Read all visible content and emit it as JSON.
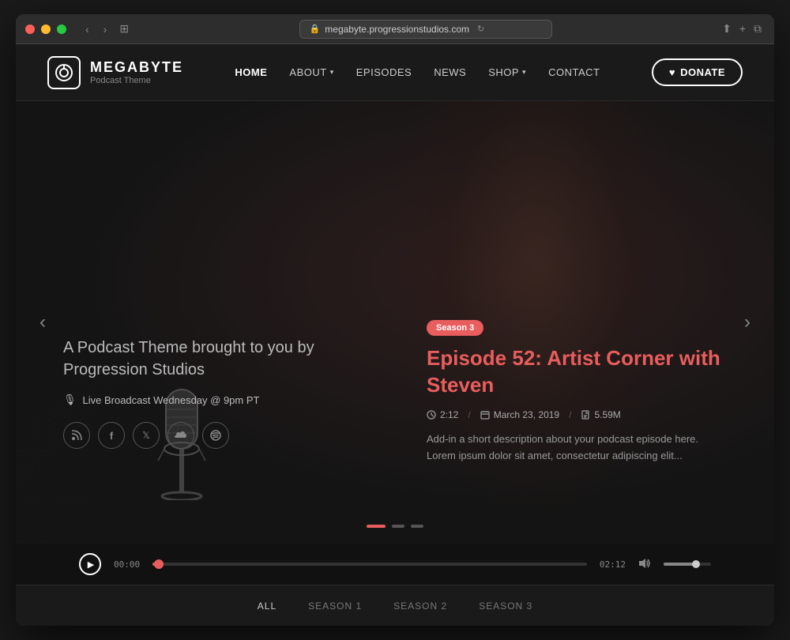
{
  "browser": {
    "url": "megabyte.progressionstudios.com",
    "reload_icon": "↻",
    "back_icon": "‹",
    "forward_icon": "›",
    "share_icon": "⬆",
    "add_tab_icon": "+",
    "tab_icon": "⧉"
  },
  "logo": {
    "icon": "📡",
    "title": "MEGABYTE",
    "subtitle": "Podcast Theme"
  },
  "nav": {
    "home": "HOME",
    "about": "ABOUT",
    "episodes": "EPISODES",
    "news": "NEWS",
    "shop": "SHOP",
    "contact": "CONTACT",
    "donate": "DONATE"
  },
  "hero": {
    "tagline": "A Podcast Theme brought to you by Progression Studios",
    "live_badge": "Live Broadcast Wednesday @ 9pm PT",
    "season_badge": "Season 3",
    "episode_title": "Episode 52: Artist Corner with Steven",
    "duration": "2:12",
    "date": "March 23, 2019",
    "file_size": "5.59M",
    "description": "Add-in a short description about your podcast episode here. Lorem ipsum dolor sit amet, consectetur adipiscing elit...",
    "prev_icon": "‹",
    "next_icon": "›"
  },
  "social": {
    "rss": "R",
    "facebook": "f",
    "twitter": "t",
    "soundcloud": "S",
    "spotify": "s"
  },
  "player": {
    "current_time": "00:00",
    "total_time": "02:12",
    "play_icon": "▶"
  },
  "filters": {
    "all": "ALL",
    "season1": "SEASON 1",
    "season2": "SEASON 2",
    "season3": "SEASON 3"
  },
  "colors": {
    "accent": "#e85d5d",
    "bg_dark": "#1a1a1a",
    "bg_darker": "#111111"
  }
}
